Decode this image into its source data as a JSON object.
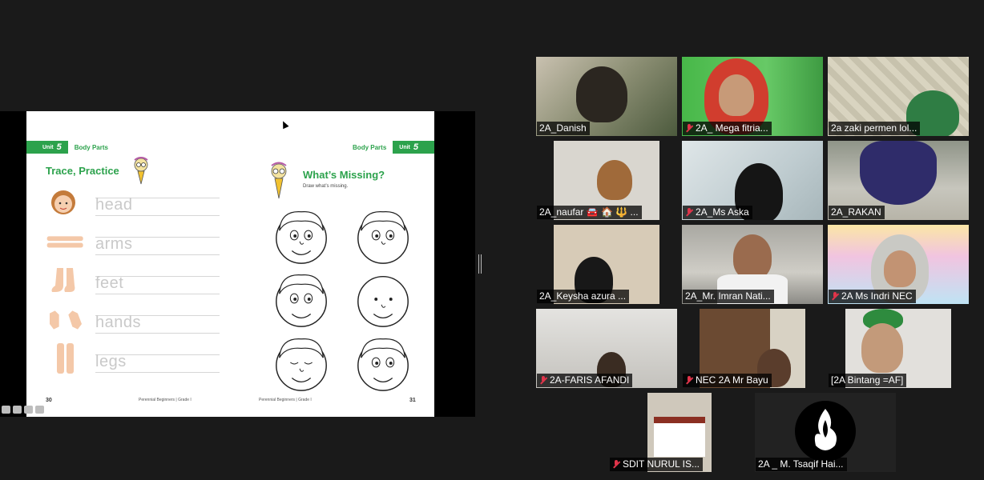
{
  "book": {
    "left_page": {
      "unit_label": "Unit",
      "unit_number": "5",
      "topic": "Body Parts",
      "title": "Trace, Practice",
      "words": [
        "head",
        "arms",
        "feet",
        "hands",
        "legs"
      ],
      "page_number": "30",
      "footer": "Perennial Beginners | Grade I"
    },
    "right_page": {
      "unit_label": "Unit",
      "unit_number": "5",
      "topic": "Body Parts",
      "title": "What’s Missing?",
      "subtitle": "Draw what’s missing.",
      "page_number": "31",
      "footer": "Perennial Beginners | Grade I"
    }
  },
  "participants": [
    {
      "name": "2A_Danish",
      "muted": false,
      "active": false
    },
    {
      "name": "2A_ Mega fitria...",
      "muted": true,
      "active": false
    },
    {
      "name": "2a zaki permen lol...",
      "muted": false,
      "active": false
    },
    {
      "name": "2A_naufar 🚘 🏠 🔱 ...",
      "muted": false,
      "active": false
    },
    {
      "name": "2A_Ms Aska",
      "muted": true,
      "active": false
    },
    {
      "name": "2A_RAKAN",
      "muted": false,
      "active": false
    },
    {
      "name": "2A_Keysha azura ...",
      "muted": false,
      "active": false
    },
    {
      "name": "2A_Mr. Imran Nati...",
      "muted": false,
      "active": true
    },
    {
      "name": "2A Ms Indri NEC",
      "muted": true,
      "active": false
    },
    {
      "name": "2A-FARIS AFANDI",
      "muted": true,
      "active": false
    },
    {
      "name": "NEC 2A Mr Bayu",
      "muted": true,
      "active": false
    },
    {
      "name": "[2A Bintang =AF]",
      "muted": false,
      "active": false
    },
    {
      "name": "SDIT NURUL IS...",
      "muted": true,
      "active": false
    },
    {
      "name": "2A _ M. Tsaqif Hai...",
      "muted": false,
      "active": false
    }
  ]
}
